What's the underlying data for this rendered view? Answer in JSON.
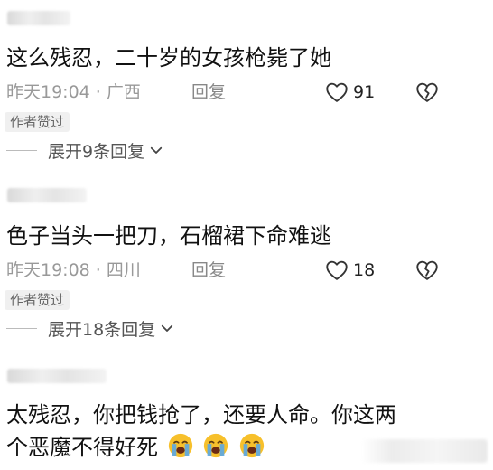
{
  "comments": [
    {
      "text": "这么残忍，二十岁的女孩枪毙了她",
      "time_location": "昨天19:04 · 广西",
      "reply_label": "回复",
      "like_count": "91",
      "badge": "作者赞过",
      "expand_label": "展开9条回复"
    },
    {
      "text": "色子当头一把刀，石榴裙下命难逃",
      "time_location": "昨天19:08 · 四川",
      "reply_label": "回复",
      "like_count": "18",
      "badge": "作者赞过",
      "expand_label": "展开18条回复"
    },
    {
      "text_line1": "太残忍，你把钱抢了，还要人命。你这两",
      "text_line2": "个恶魔不得好死"
    }
  ],
  "icons": {
    "like": "heart-outline-icon",
    "dislike": "broken-heart-icon",
    "expand": "chevron-down-icon",
    "emoji": "loudly-crying-face-emoji"
  },
  "colors": {
    "meta_text": "#999999",
    "badge_bg": "#f0f0f0",
    "emoji_face": "#f7c02b",
    "tears": "#5aa7e6"
  }
}
